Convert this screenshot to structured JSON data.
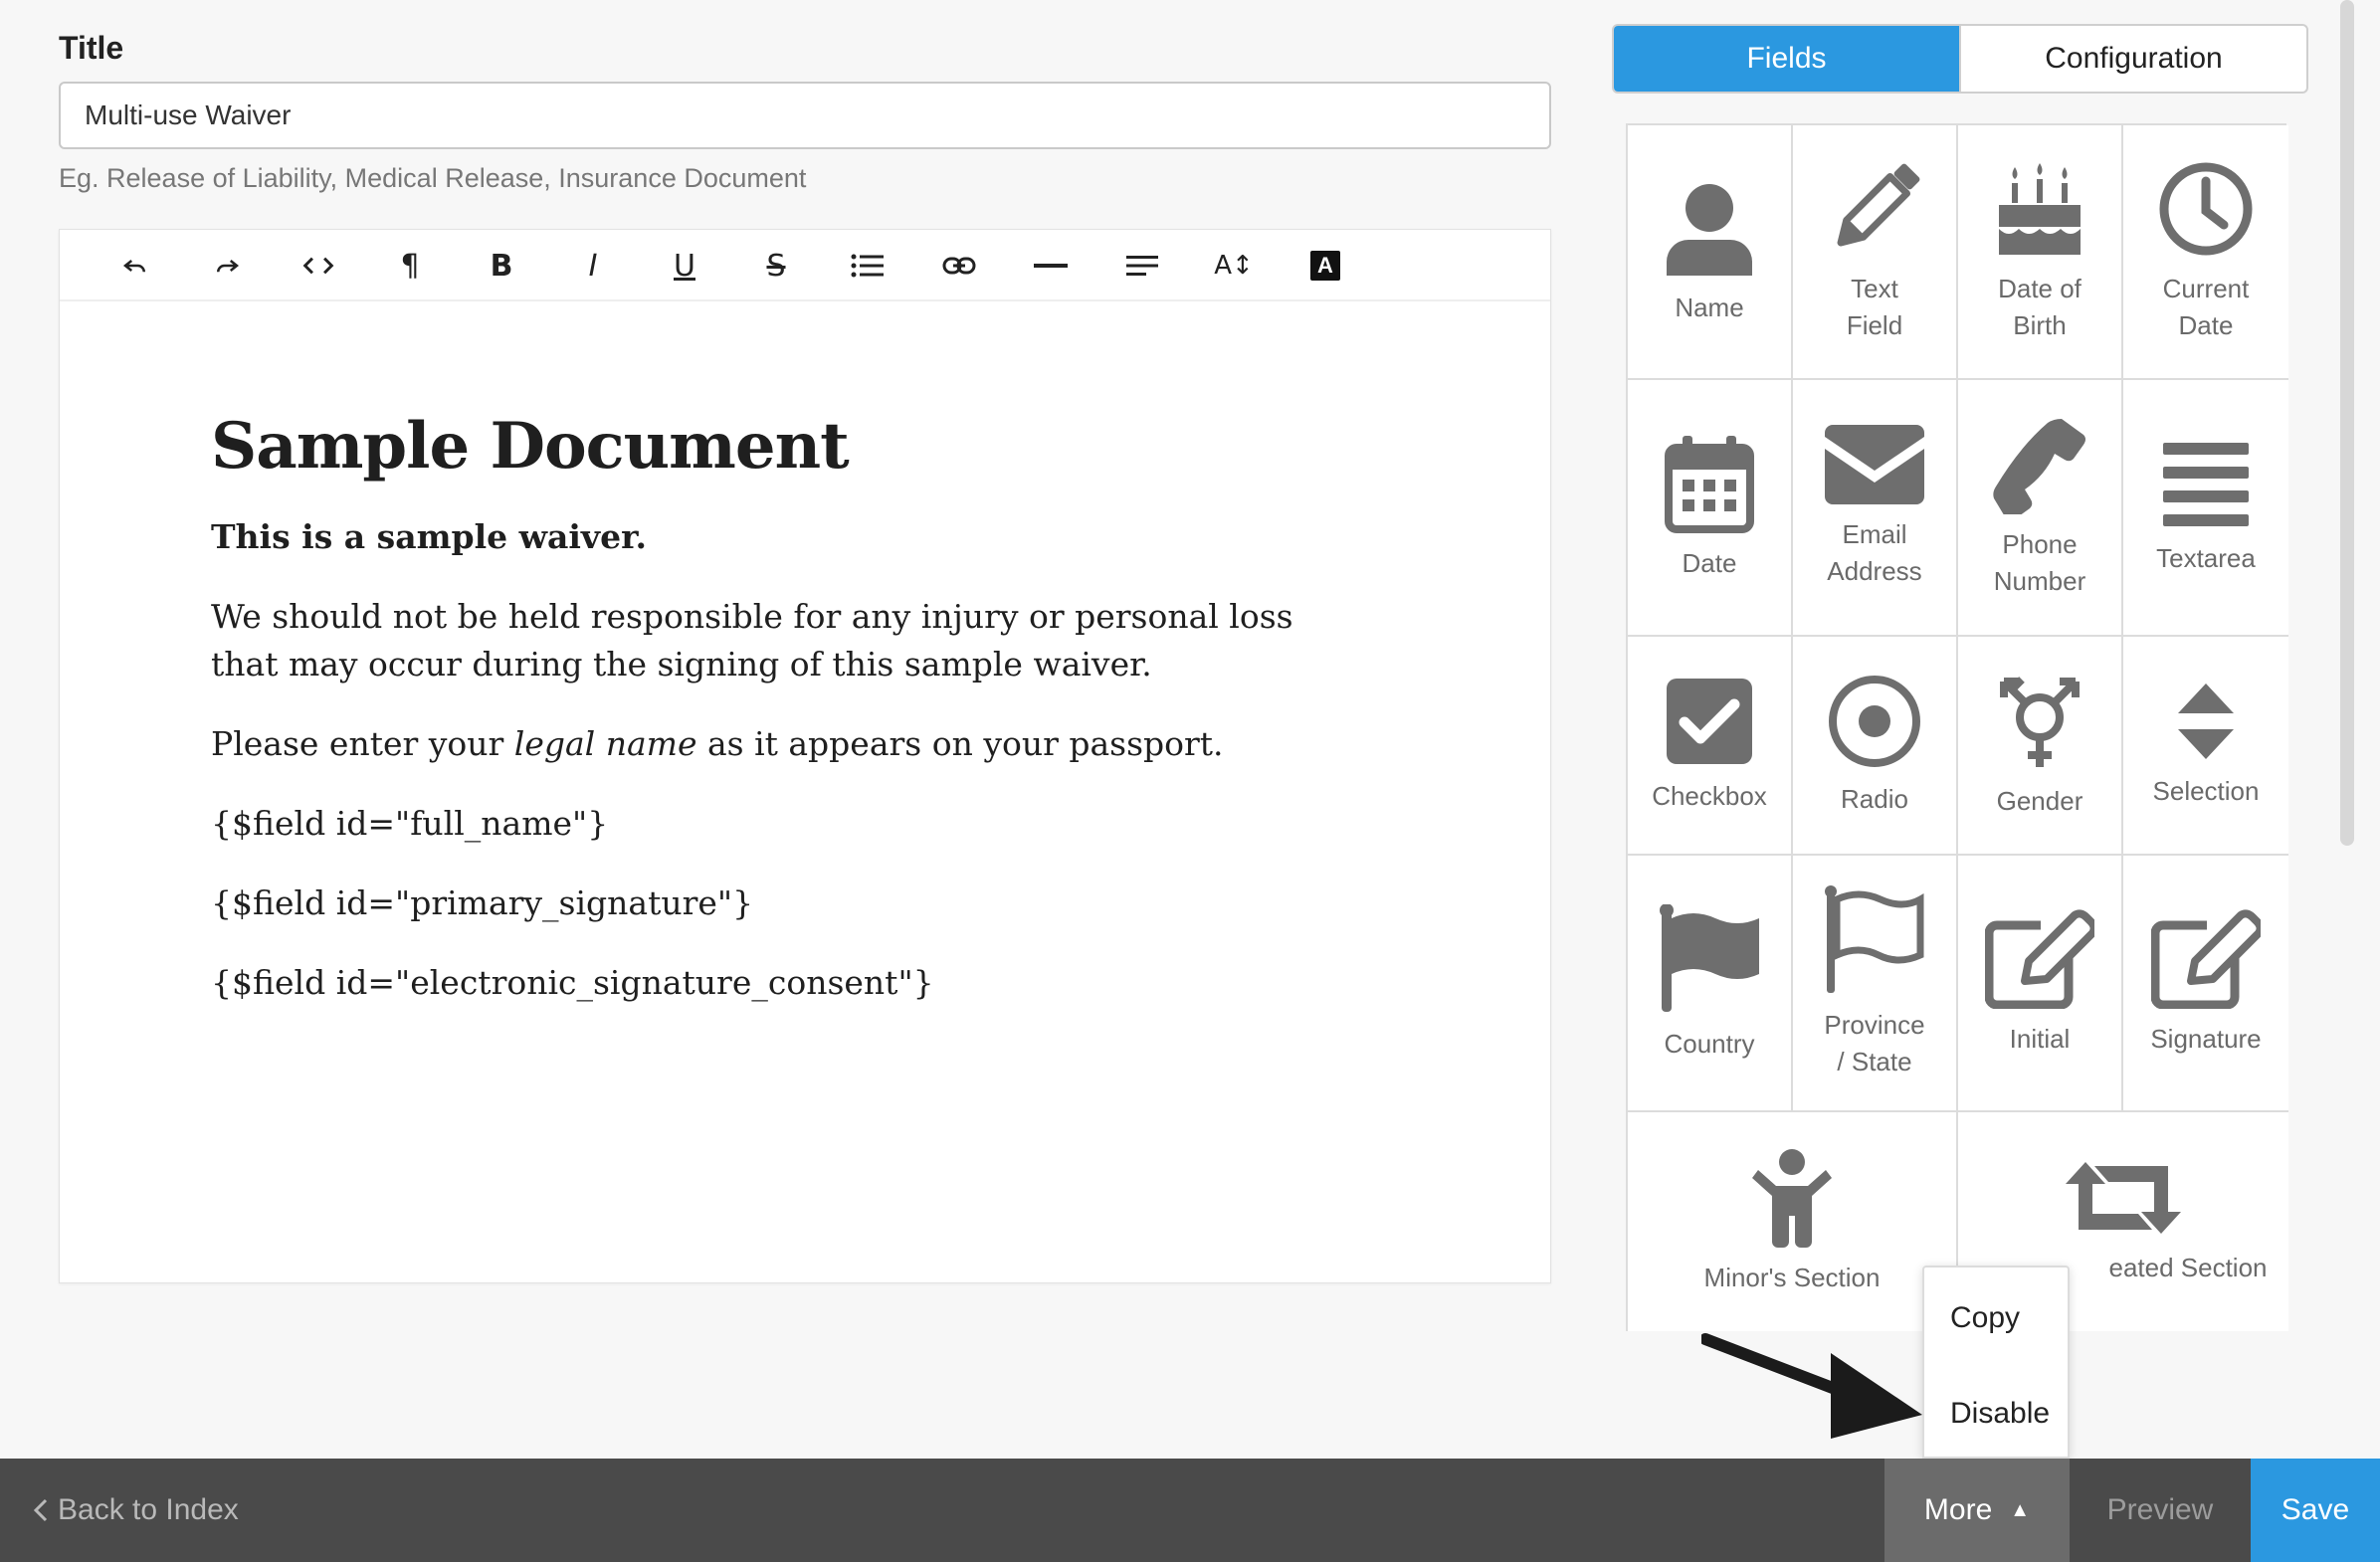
{
  "title_field": {
    "label": "Title",
    "value": "Multi-use Waiver",
    "help": "Eg. Release of Liability, Medical Release, Insurance Document"
  },
  "toolbar": {
    "buttons": [
      {
        "name": "undo-icon",
        "glyph": "↶"
      },
      {
        "name": "redo-icon",
        "glyph": "↷"
      },
      {
        "name": "code-view-icon",
        "glyph": "<>"
      },
      {
        "name": "paragraph-icon",
        "glyph": "¶"
      },
      {
        "name": "bold-icon",
        "glyph": "B"
      },
      {
        "name": "italic-icon",
        "glyph": "I"
      },
      {
        "name": "underline-icon",
        "glyph": "U"
      },
      {
        "name": "strikethrough-icon",
        "glyph": "S"
      },
      {
        "name": "list-icon",
        "glyph": "☰"
      },
      {
        "name": "link-icon",
        "glyph": "⛓"
      },
      {
        "name": "horizontal-rule-icon",
        "glyph": "—"
      },
      {
        "name": "align-icon",
        "glyph": "≡"
      },
      {
        "name": "font-size-icon",
        "glyph": "A↕"
      },
      {
        "name": "text-color-icon",
        "glyph": "A"
      }
    ]
  },
  "document": {
    "heading": "Sample Document",
    "intro": "This is a sample waiver.",
    "para1": "We should not be held responsible for any injury or personal loss that may occur during the signing of this sample waiver.",
    "para2_pre": "Please enter your ",
    "para2_em": "legal name",
    "para2_post": " as it appears on your passport.",
    "field1": "{$field id=\"full_name\"}",
    "field2": "{$field id=\"primary_signature\"}",
    "field3": "{$field id=\"electronic_signature_consent\"}"
  },
  "tabs": {
    "fields": "Fields",
    "configuration": "Configuration"
  },
  "fields": [
    {
      "label": "Name",
      "icon": "user-icon"
    },
    {
      "label": "Text\nField",
      "icon": "pencil-icon"
    },
    {
      "label": "Date of\nBirth",
      "icon": "birthday-cake-icon"
    },
    {
      "label": "Current\nDate",
      "icon": "clock-icon"
    },
    {
      "label": "Date",
      "icon": "calendar-icon"
    },
    {
      "label": "Email\nAddress",
      "icon": "envelope-icon"
    },
    {
      "label": "Phone\nNumber",
      "icon": "phone-icon"
    },
    {
      "label": "Textarea",
      "icon": "textarea-icon"
    },
    {
      "label": "Checkbox",
      "icon": "checkbox-icon"
    },
    {
      "label": "Radio",
      "icon": "radio-icon"
    },
    {
      "label": "Gender",
      "icon": "gender-icon"
    },
    {
      "label": "Selection",
      "icon": "sort-icon"
    },
    {
      "label": "Country",
      "icon": "flag-icon"
    },
    {
      "label": "Province\n/ State",
      "icon": "flag-outline-icon"
    },
    {
      "label": "Initial",
      "icon": "edit-icon"
    },
    {
      "label": "Signature",
      "icon": "edit-signature-icon"
    },
    {
      "label": "Minor's Section",
      "icon": "child-icon"
    },
    {
      "label": "eated Section",
      "icon": "retweet-icon"
    }
  ],
  "menu": {
    "copy": "Copy",
    "disable": "Disable"
  },
  "bottom": {
    "back": "Back to Index",
    "more": "More",
    "preview": "Preview",
    "save": "Save"
  },
  "colors": {
    "accent": "#2b98e0",
    "icon_gray": "#6e6e6e",
    "bottom_bar": "#4a4a4a"
  }
}
